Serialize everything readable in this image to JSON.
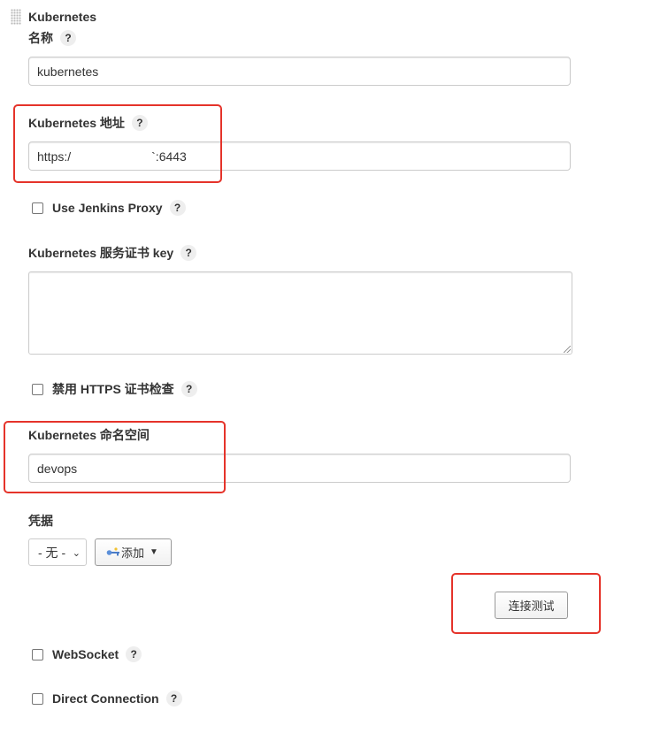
{
  "section": {
    "title": "Kubernetes"
  },
  "fields": {
    "name": {
      "label": "名称",
      "value": "kubernetes"
    },
    "address": {
      "label": "Kubernetes 地址",
      "value_start": "https:/",
      "value_end": "`:6443"
    },
    "use_proxy": {
      "label": "Use Jenkins Proxy"
    },
    "server_key": {
      "label": "Kubernetes 服务证书 key",
      "value": ""
    },
    "disable_https": {
      "label": "禁用 HTTPS 证书检查"
    },
    "namespace": {
      "label": "Kubernetes 命名空间",
      "value": "devops"
    },
    "credentials": {
      "label": "凭据",
      "selected": "- 无 -",
      "add_label": "添加"
    },
    "test_connection": {
      "label": "连接测试"
    },
    "websocket": {
      "label": "WebSocket"
    },
    "direct_connection": {
      "label": "Direct Connection"
    }
  },
  "help_glyph": "?",
  "colors": {
    "highlight": "#e5332a"
  }
}
